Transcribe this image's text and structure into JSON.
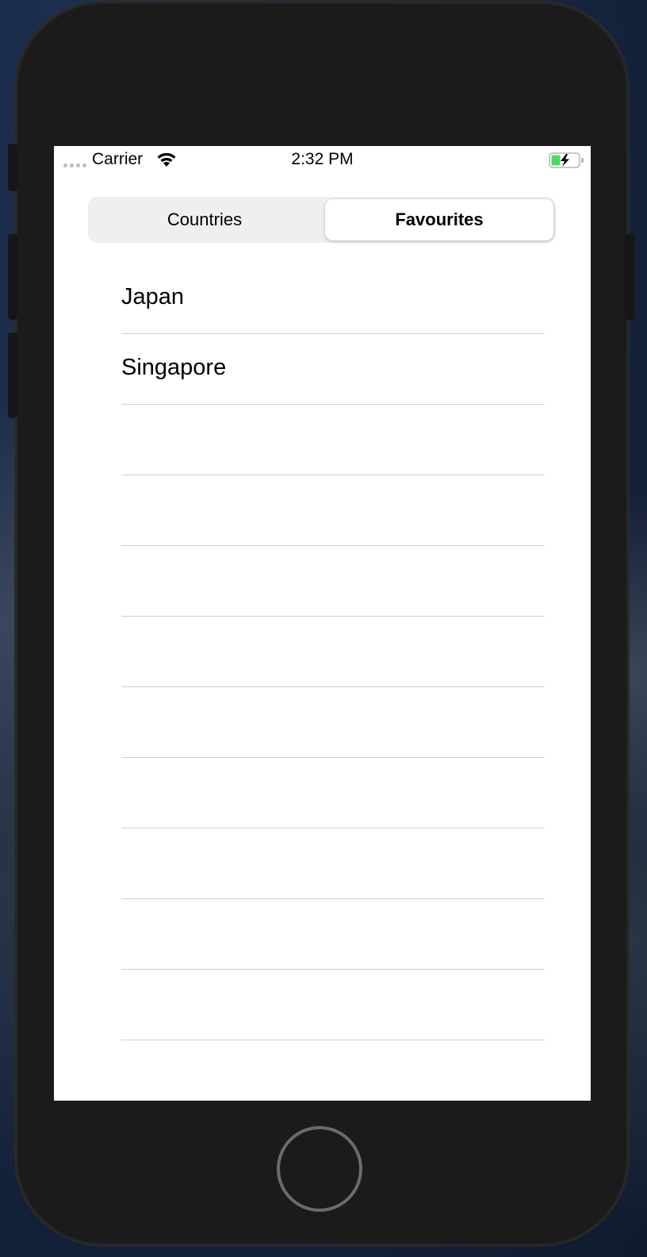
{
  "status_bar": {
    "carrier": "Carrier",
    "time": "2:32 PM",
    "signal_icon": "signal-dots-icon",
    "wifi_icon": "wifi-icon",
    "battery_icon": "battery-charging-icon",
    "battery_color": "#4cd964"
  },
  "segmented_control": {
    "segments": [
      {
        "label": "Countries",
        "selected": false
      },
      {
        "label": "Favourites",
        "selected": true
      }
    ]
  },
  "list": {
    "rows": [
      {
        "label": "Japan"
      },
      {
        "label": "Singapore"
      },
      {
        "label": ""
      },
      {
        "label": ""
      },
      {
        "label": ""
      },
      {
        "label": ""
      },
      {
        "label": ""
      },
      {
        "label": ""
      },
      {
        "label": ""
      },
      {
        "label": ""
      },
      {
        "label": ""
      },
      {
        "label": ""
      }
    ]
  },
  "device": {
    "home_button": "home-button"
  }
}
